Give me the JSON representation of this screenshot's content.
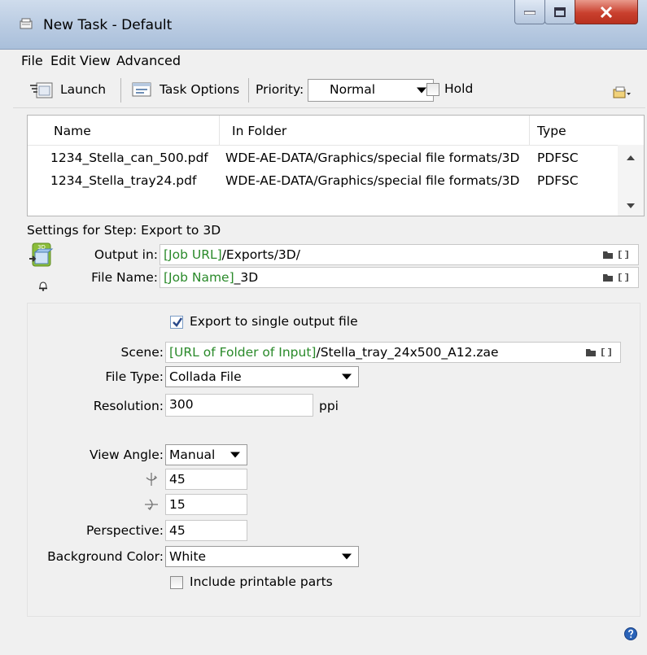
{
  "window": {
    "title": "New Task - Default"
  },
  "menu": [
    "File",
    "Edit",
    "View",
    "Advanced"
  ],
  "toolbar": {
    "launch_label": "Launch",
    "task_options_label": "Task Options",
    "priority_label": "Priority:",
    "priority_value": "Normal",
    "hold_label": "Hold",
    "hold_checked": false
  },
  "file_list": {
    "columns": [
      "Name",
      "In Folder",
      "Type"
    ],
    "rows": [
      {
        "name": "1234_Stella_can_500.pdf",
        "folder": "WDE-AE-DATA/Graphics/special file formats/3D",
        "type": "PDFSC"
      },
      {
        "name": "1234_Stella_tray24.pdf",
        "folder": "WDE-AE-DATA/Graphics/special file formats/3D",
        "type": "PDFSC"
      }
    ]
  },
  "step": {
    "settings_label": "Settings for Step: Export to 3D",
    "step_icon_label": "3D",
    "output_in_label": "Output in:",
    "output_in_token": "[Job URL]",
    "output_in_path": "/Exports/3D/",
    "file_name_label": "File Name:",
    "file_name_token": "[Job Name]",
    "file_name_suffix": "_3D"
  },
  "options": {
    "export_single_label": "Export to single output file",
    "export_single_checked": true,
    "scene_label": "Scene:",
    "scene_token": "[URL of Folder of Input]",
    "scene_path": "/Stella_tray_24x500_A12.zae",
    "file_type_label": "File Type:",
    "file_type_value": "Collada File",
    "resolution_label": "Resolution:",
    "resolution_value": "300",
    "resolution_unit": "ppi",
    "view_angle_label": "View Angle:",
    "view_angle_value": "Manual",
    "angle_vertical_value": "45",
    "angle_horizontal_value": "15",
    "perspective_label": "Perspective:",
    "perspective_value": "45",
    "background_label": "Background Color:",
    "background_value": "White",
    "include_printable_label": "Include printable parts",
    "include_printable_checked": false
  },
  "colors": {
    "token_green": "#2a8a2a",
    "close_red": "#c9402e",
    "title_blue": "#b9cbe2"
  }
}
